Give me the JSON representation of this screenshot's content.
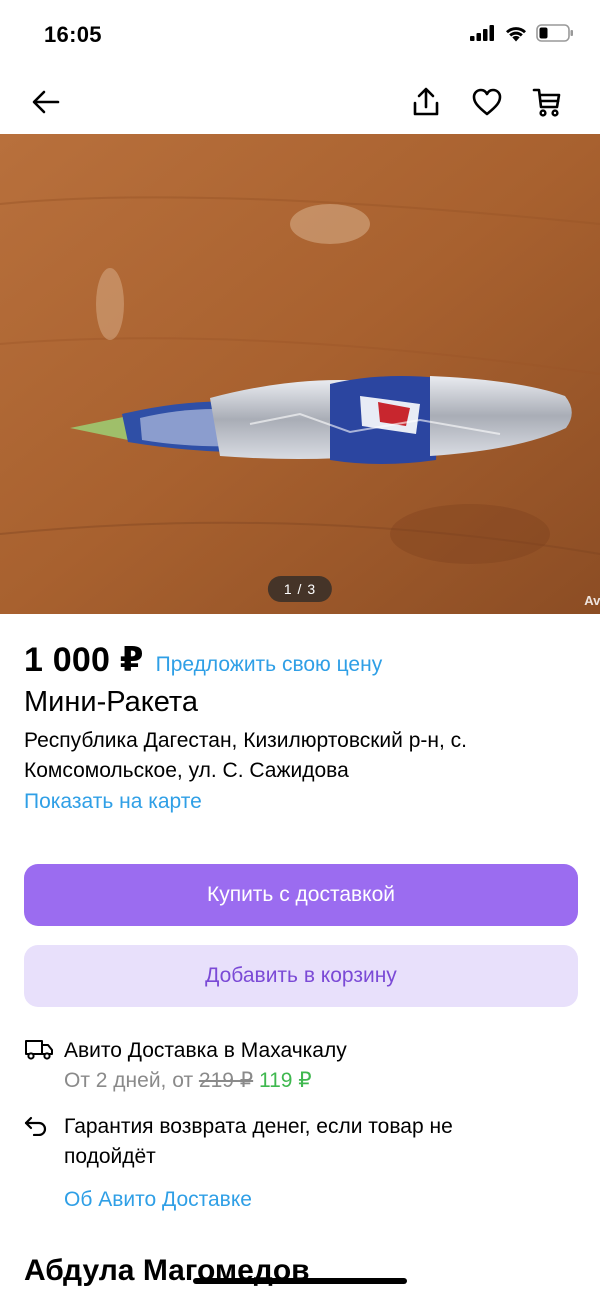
{
  "status_bar": {
    "time": "16:05"
  },
  "gallery": {
    "indicator": "1 / 3",
    "watermark": "Avi"
  },
  "listing": {
    "price": "1 000 ₽",
    "offer_link": "Предложить свою цену",
    "title": "Мини-Ракета",
    "address": "Республика Дагестан, Кизилюртовский р-н, с. Комсомольское, ул. С. Сажидова",
    "map_link": "Показать на карте"
  },
  "actions": {
    "buy_label": "Купить с доставкой",
    "cart_label": "Добавить в корзину"
  },
  "delivery": {
    "title": "Авито Доставка в Махачкалу",
    "eta_prefix": "От 2 дней, от ",
    "old_price": "219 ₽",
    "new_price": "119 ₽",
    "guarantee": "Гарантия возврата денег, если товар не подойдёт",
    "about_link": "Об Авито Доставке"
  },
  "seller": {
    "name": "Абдула Магомедов"
  },
  "icons": [
    "back-arrow-icon",
    "share-icon",
    "favorite-heart-icon",
    "cart-icon",
    "truck-icon",
    "return-arrow-icon",
    "signal-icon",
    "wifi-icon",
    "battery-icon"
  ],
  "colors": {
    "accent": "#9b6cf0",
    "accent_light": "#e8e0fb",
    "link": "#2f9fe6",
    "discount": "#3fb84f"
  }
}
